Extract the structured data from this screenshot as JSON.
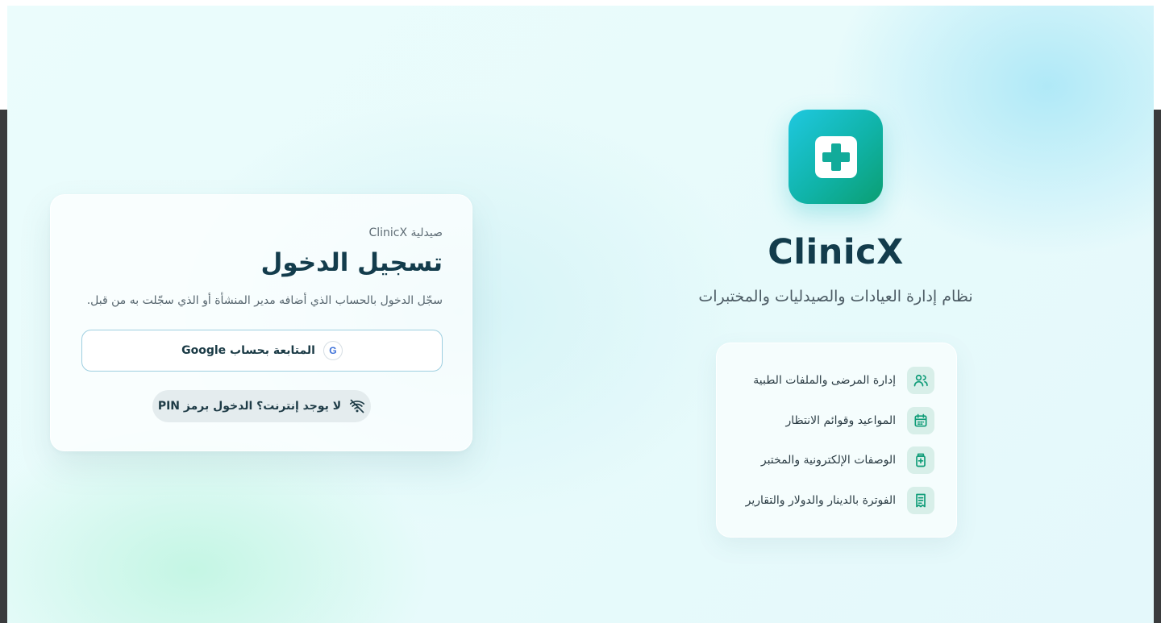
{
  "login": {
    "eyebrow": "صيدلية ClinicX",
    "title": "تسجيل الدخول",
    "subtitle": "سجّل الدخول بالحساب الذي أضافه مدير المنشأة أو الذي سجّلت به من قبل.",
    "google_badge": "G",
    "google_label": "المتابعة بحساب Google",
    "pin_label": "لا يوجد إنترنت؟ الدخول برمز PIN"
  },
  "brand": {
    "name": "ClinicX",
    "tagline": "نظام إدارة العيادات والصيدليات والمختبرات"
  },
  "features": [
    {
      "label": "إدارة المرضى والملفات الطبية",
      "icon": "users-icon"
    },
    {
      "label": "المواعيد وقوائم الانتظار",
      "icon": "calendar-icon"
    },
    {
      "label": "الوصفات الإلكترونية والمختبر",
      "icon": "prescription-icon"
    },
    {
      "label": "الفوترة بالدينار والدولار والتقارير",
      "icon": "receipt-icon"
    }
  ],
  "colors": {
    "brand_teal": "#10b3a8",
    "brand_cyan": "#1fc8e0",
    "brand_green": "#0b9e72",
    "heading": "#133c4c",
    "feature_icon_bg": "#d8efe9",
    "feature_icon_fg": "#0f9c78"
  }
}
